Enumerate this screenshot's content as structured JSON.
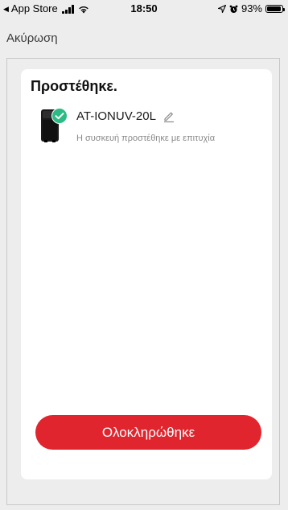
{
  "status_bar": {
    "back_app": "App Store",
    "time": "18:50",
    "battery": "93%",
    "battery_level": 0.93
  },
  "nav": {
    "cancel_label": "Ακύρωση"
  },
  "card": {
    "title": "Προστέθηκε.",
    "device": {
      "name": "AT-IONUV-20L",
      "status_text": "Η συσκευή προστέθηκε με επιτυχία"
    },
    "done_label": "Ολοκληρώθηκε"
  },
  "colors": {
    "accent": "#e0252e",
    "check": "#2bbb84",
    "background": "#ededed",
    "card": "#ffffff"
  }
}
